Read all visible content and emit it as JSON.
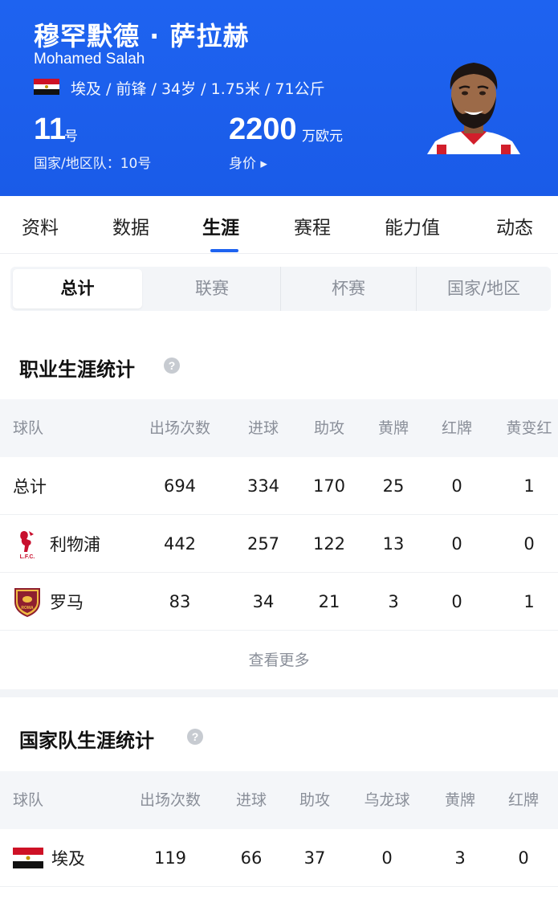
{
  "header": {
    "name_cn": "穆罕默德 · 萨拉赫",
    "name_en": "Mohamed Salah",
    "bio": "埃及 / 前锋 / 34岁 / 1.75米 / 71公斤",
    "flag_icon": "egypt-flag-icon",
    "shirt_number": "11",
    "shirt_unit": "号",
    "national_number": "国家/地区队：10号",
    "market_value": "2200",
    "market_value_unit": "万欧元",
    "market_value_label": "身价 ▸"
  },
  "tabs": [
    "资料",
    "数据",
    "生涯",
    "赛程",
    "能力值",
    "动态"
  ],
  "active_tab": "生涯",
  "segments": [
    "总计",
    "联赛",
    "杯赛",
    "国家/地区"
  ],
  "active_segment": "总计",
  "career": {
    "title": "职业生涯统计",
    "headers": [
      "球队",
      "出场次数",
      "进球",
      "助攻",
      "黄牌",
      "红牌",
      "黄变红"
    ],
    "rows": [
      {
        "team": "总计",
        "icon": "",
        "values": [
          "694",
          "334",
          "170",
          "25",
          "0",
          "1"
        ]
      },
      {
        "team": "利物浦",
        "icon": "liverpool-crest-icon",
        "values": [
          "442",
          "257",
          "122",
          "13",
          "0",
          "0"
        ]
      },
      {
        "team": "罗马",
        "icon": "roma-crest-icon",
        "values": [
          "83",
          "34",
          "21",
          "3",
          "0",
          "1"
        ]
      }
    ],
    "more": "查看更多"
  },
  "national": {
    "title": "国家队生涯统计",
    "headers": [
      "球队",
      "出场次数",
      "进球",
      "助攻",
      "乌龙球",
      "黄牌",
      "红牌"
    ],
    "rows": [
      {
        "team": "埃及",
        "icon": "egypt-flag-icon",
        "values": [
          "119",
          "66",
          "37",
          "0",
          "3",
          "0"
        ]
      }
    ]
  },
  "colors": {
    "brand_blue": "#1e63f0",
    "muted_text": "#8a8f99",
    "table_header_bg": "#f4f6f9"
  }
}
